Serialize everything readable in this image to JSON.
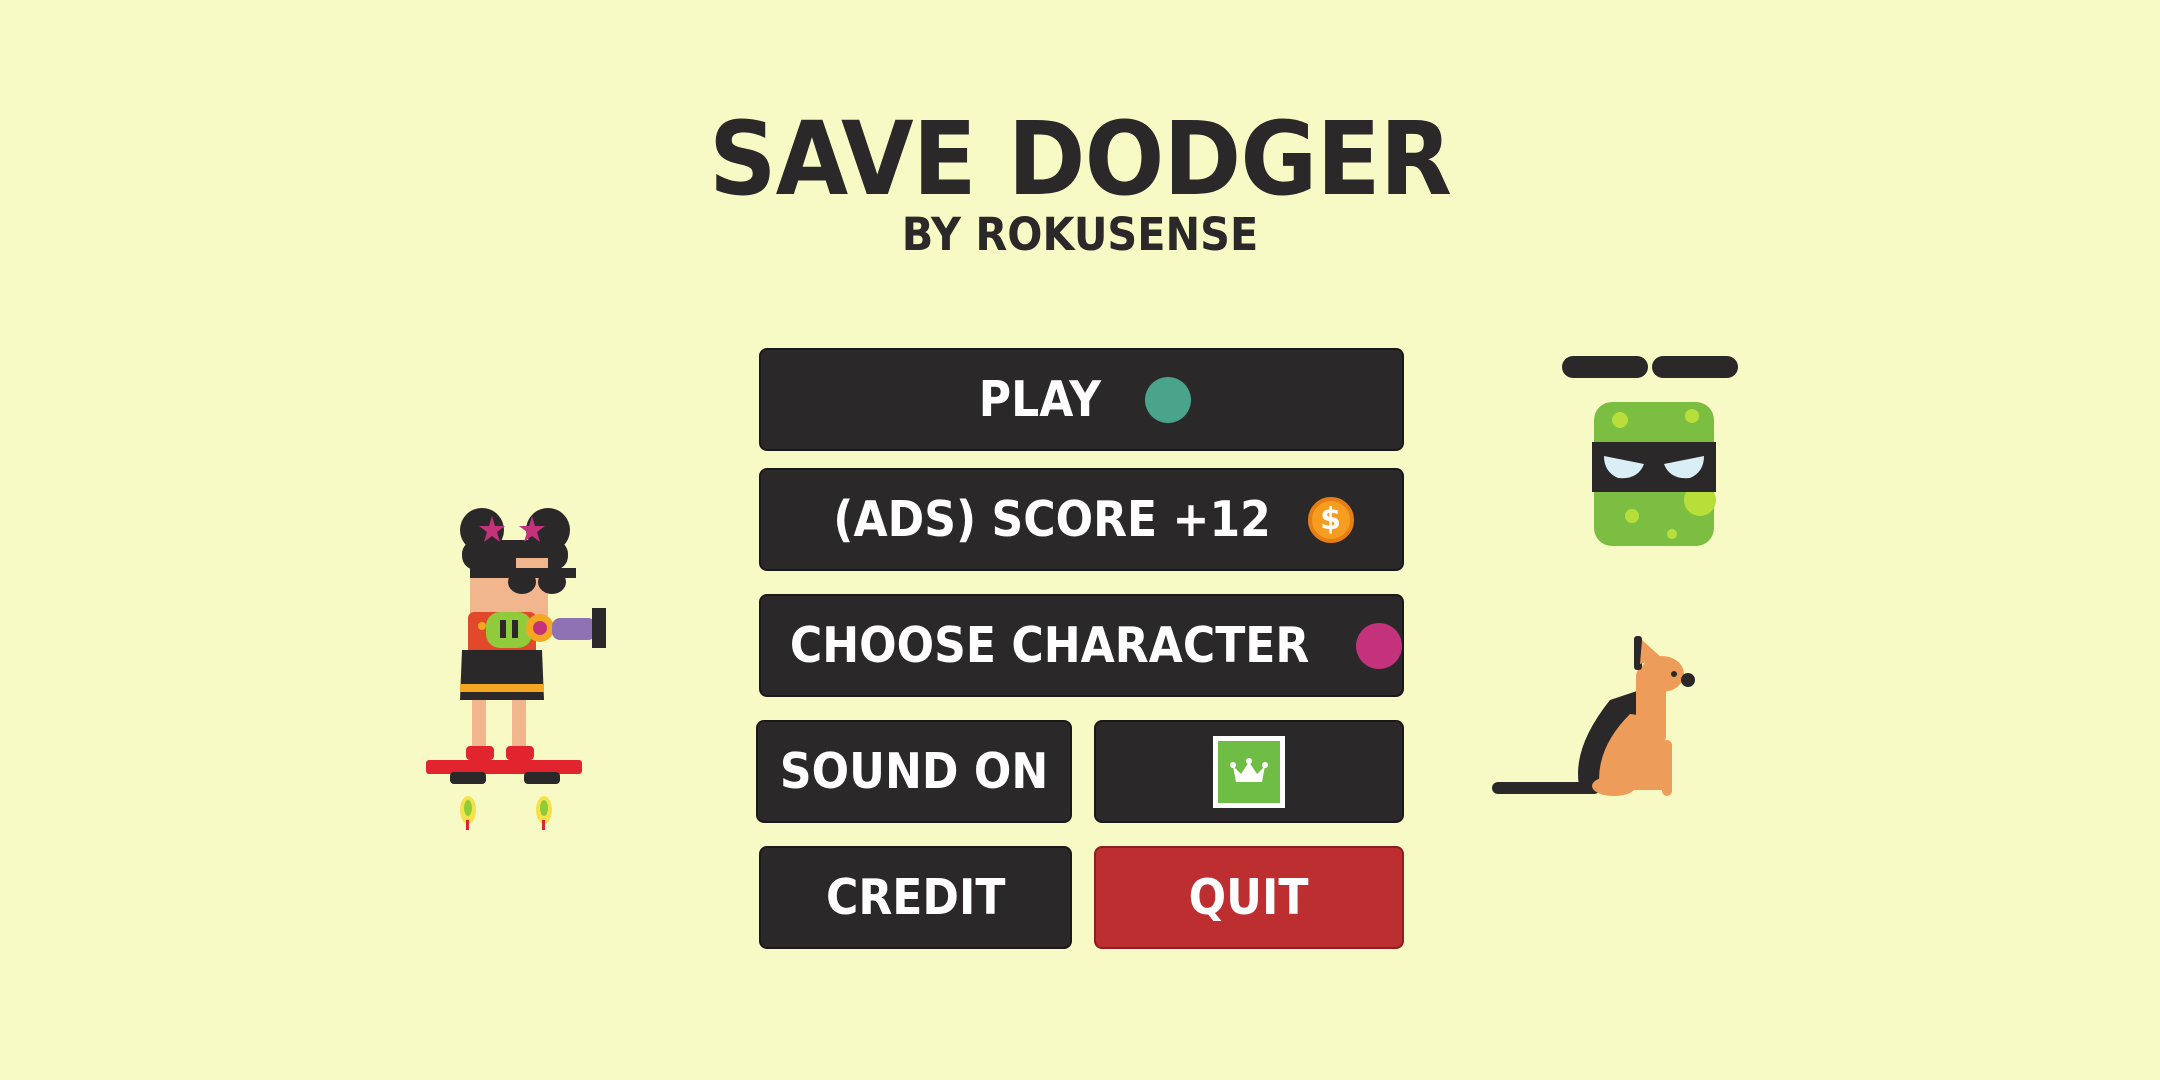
{
  "game": {
    "title": "SAVE DODGER",
    "subtitle": "BY ROKUSENSE"
  },
  "menu": {
    "play": {
      "label": "PLAY",
      "indicator_color": "#4aa48c"
    },
    "ads_score": {
      "label": "(ADS) SCORE +12",
      "coin_symbol": "$",
      "coin_color": "#f59d1f"
    },
    "choose_character": {
      "label": "CHOOSE CHARACTER",
      "indicator_color": "#c4327c"
    },
    "sound": {
      "label": "SOUND ON"
    },
    "premium": {
      "icon": "crown-icon",
      "color": "#6fbd44"
    },
    "credit": {
      "label": "CREDIT"
    },
    "quit": {
      "label": "QUIT",
      "color": "#bd2e30"
    }
  },
  "colors": {
    "background": "#f8fac6",
    "button": "#2a2829",
    "text": "#ffffff"
  },
  "characters": {
    "player": "girl-on-hoverboard",
    "enemy_drone": "green-ninja-drone",
    "enemy_dog": "sitting-dog"
  }
}
